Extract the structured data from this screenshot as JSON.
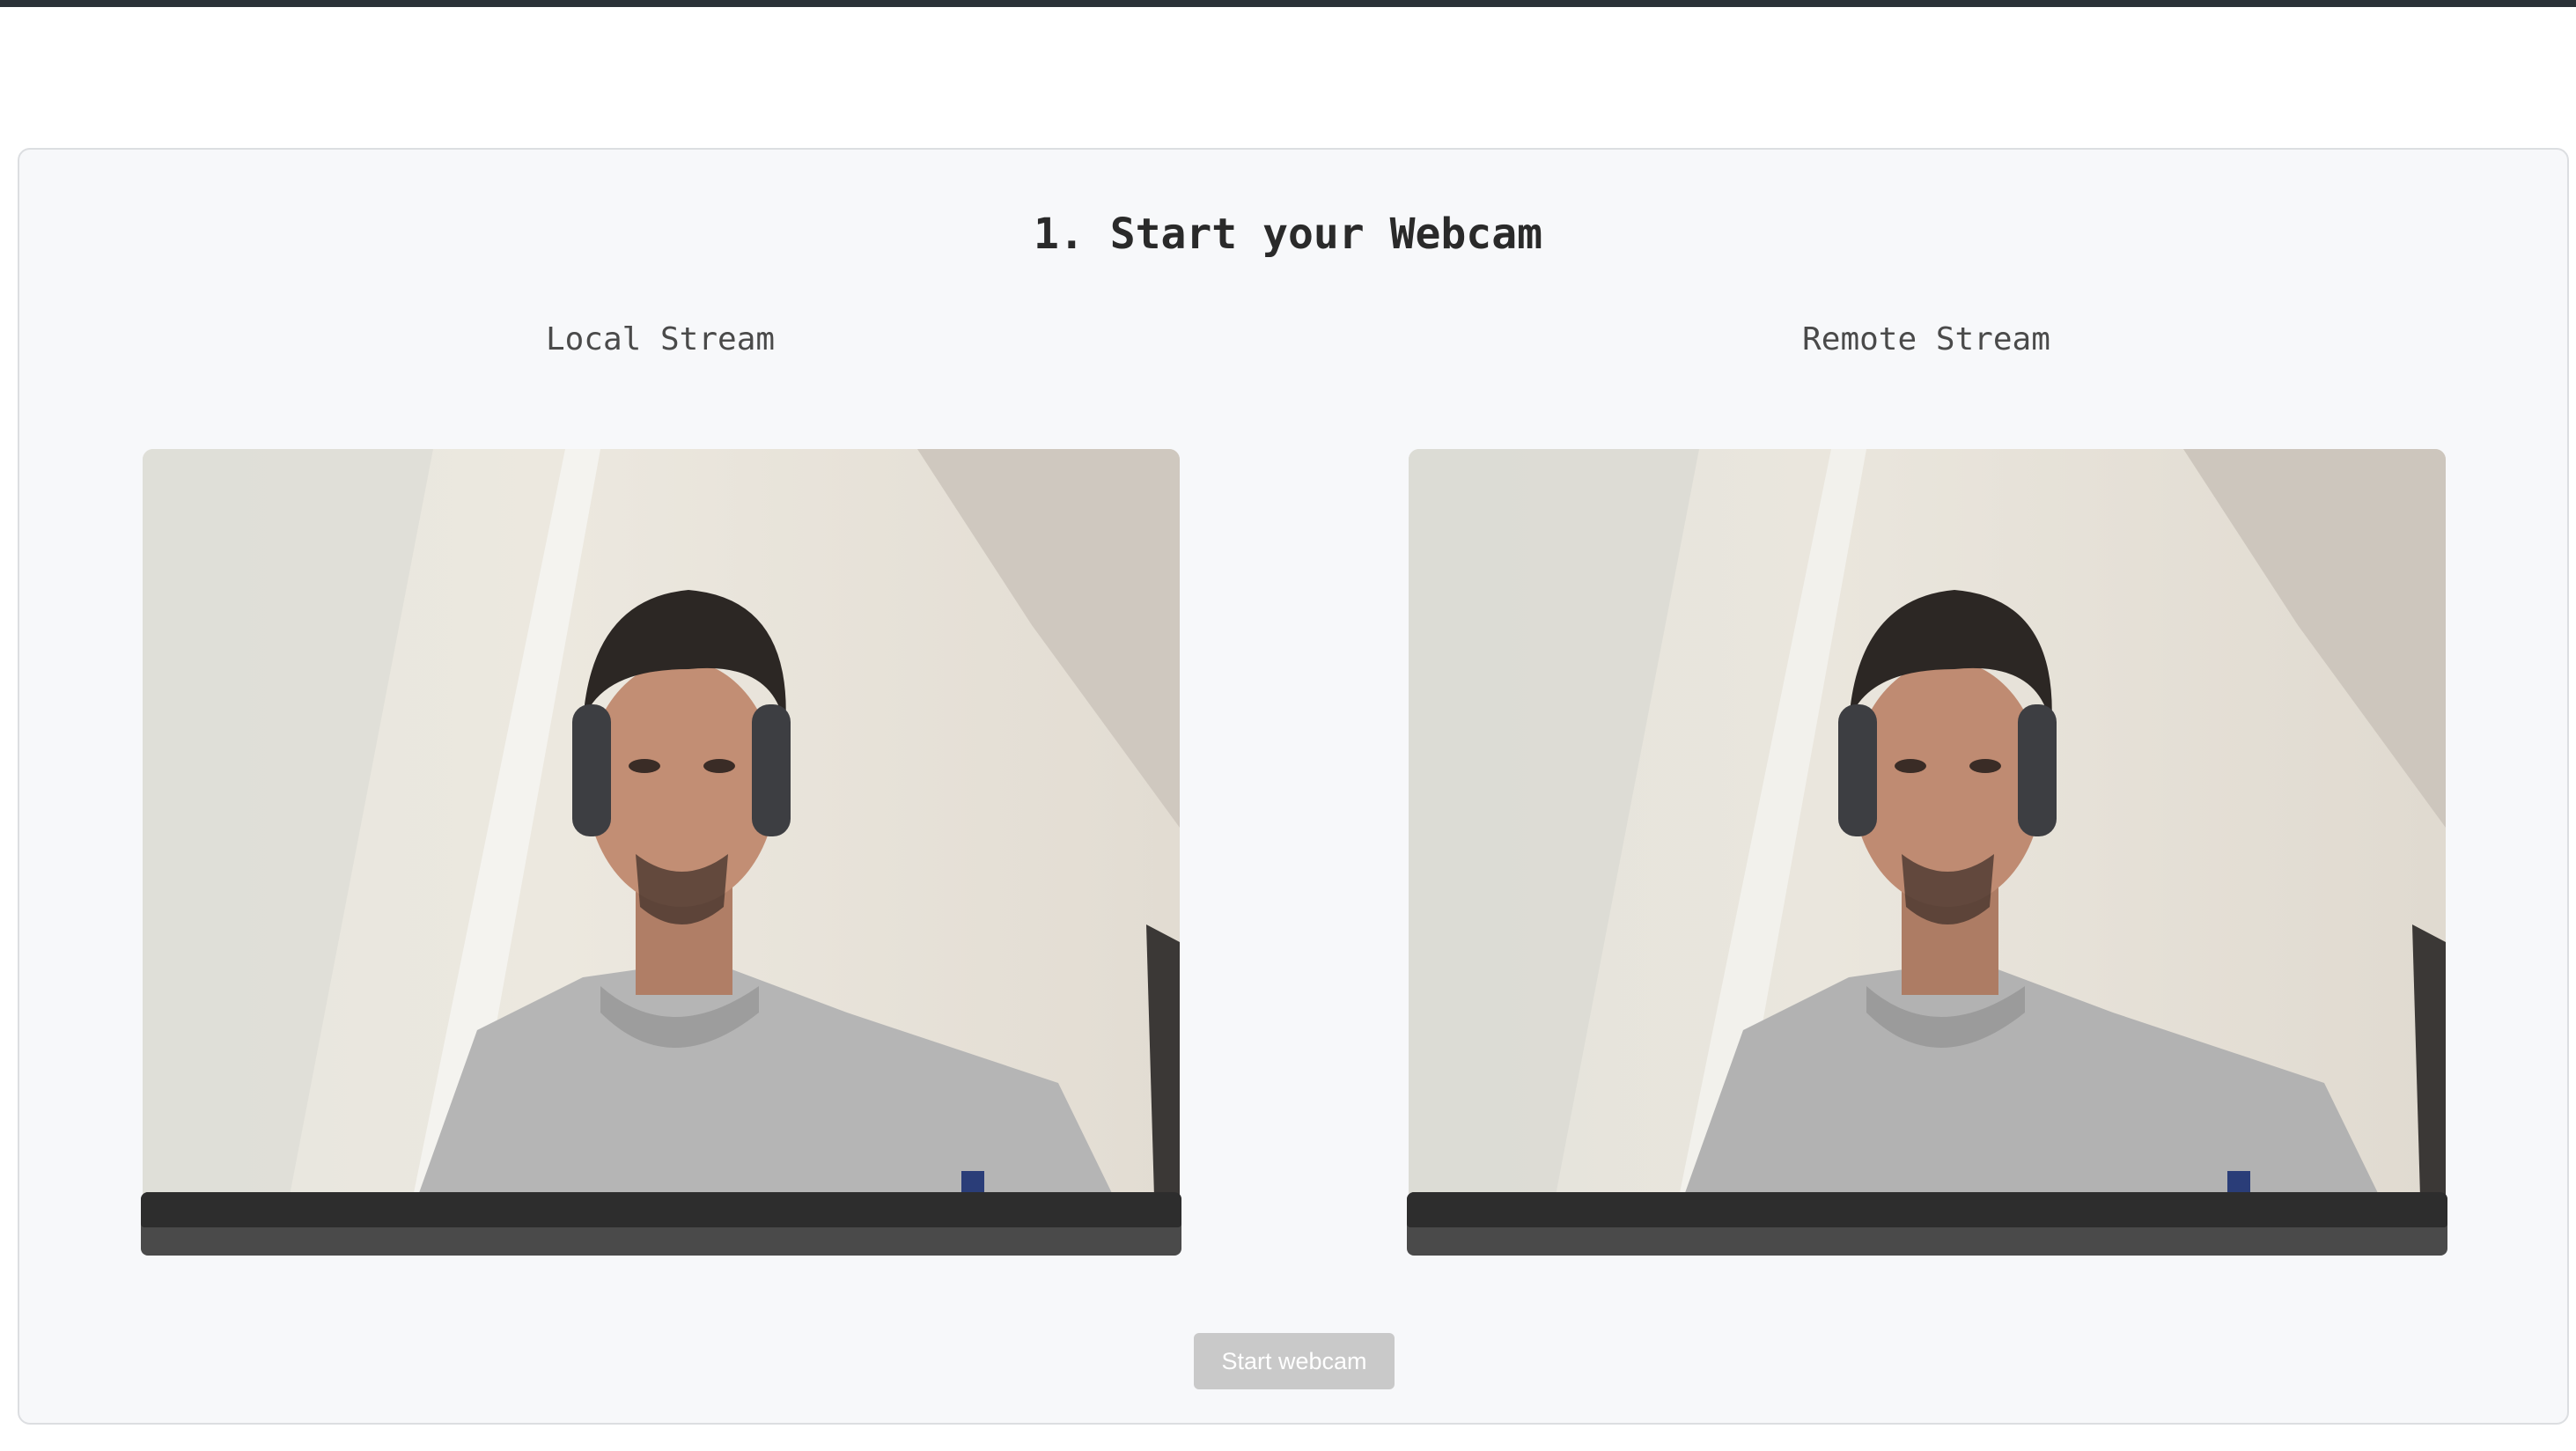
{
  "page": {
    "title": "1. Start your Webcam"
  },
  "streams": {
    "local_label": "Local Stream",
    "remote_label": "Remote Stream"
  },
  "controls": {
    "start_webcam_label": "Start webcam",
    "start_webcam_disabled": true
  },
  "colors": {
    "topbar": "#2b3238",
    "panel_bg": "#f7f8fa",
    "button_disabled": "#c9c9c9",
    "video_controls": "#4a4a4a"
  }
}
